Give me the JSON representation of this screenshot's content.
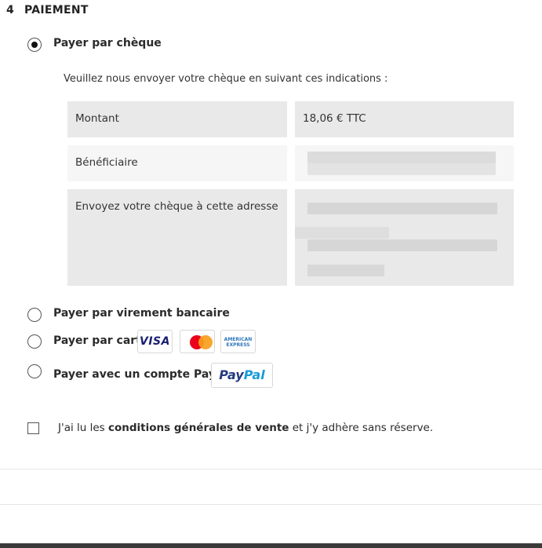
{
  "step": {
    "number": "4",
    "title": "PAIEMENT"
  },
  "payment_options": {
    "cheque": {
      "label": "Payer par chèque",
      "selected": true
    },
    "virement": {
      "label": "Payer par virement bancaire",
      "selected": false
    },
    "carte": {
      "label": "Payer par carte",
      "selected": false
    },
    "paypal": {
      "label": "Payer avec un compte PayPal",
      "selected": false
    }
  },
  "cheque_details": {
    "instructions": "Veuillez nous envoyer votre chèque en suivant ces indications :",
    "rows": [
      {
        "label": "Montant",
        "value": "18,06 € TTC"
      },
      {
        "label": "Bénéficiaire",
        "value": ""
      },
      {
        "label": "Envoyez votre chèque à cette adresse",
        "value": ""
      }
    ]
  },
  "card_logos": {
    "visa": "VISA",
    "mastercard": "",
    "amex_line1": "AMERICAN",
    "amex_line2": "EXPRESS"
  },
  "paypal_logo": {
    "part1": "Pay",
    "part2": "Pal"
  },
  "terms": {
    "prefix": "J'ai lu les ",
    "link": "conditions générales de vente",
    "suffix": " et j'y adhère sans réserve.",
    "checked": false
  },
  "colors": {
    "visa_blue": "#1a1f71",
    "mastercard_red": "#eb001b",
    "mastercard_yellow": "#f79e1b",
    "amex_blue": "#2e77bc",
    "paypal_dark": "#253b80",
    "paypal_light": "#179bd7"
  },
  "icons": [
    "radio-selected-icon",
    "radio-icon",
    "visa-icon",
    "mastercard-icon",
    "amex-icon",
    "paypal-icon",
    "checkbox-icon"
  ]
}
